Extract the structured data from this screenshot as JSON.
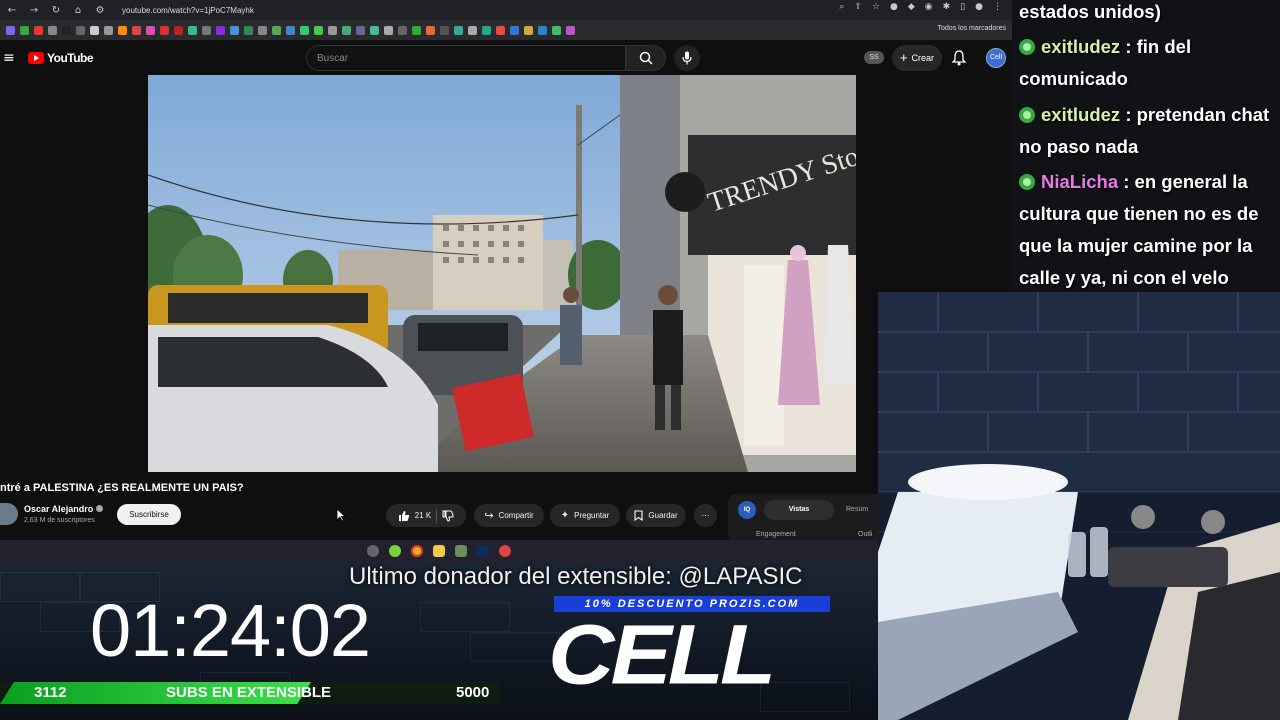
{
  "browser": {
    "url": "youtube.com/watch?v=1jPoC7Mayhk",
    "all_bookmarks": "Todos los marcadores"
  },
  "youtube": {
    "logo": "YouTube",
    "search_placeholder": "Buscar",
    "create_label": "Crear",
    "ss_badge": "SS",
    "avatar_label": "Cell"
  },
  "video": {
    "title": "ntré a PALESTINA ¿ES REALMENTE UN PAIS?",
    "channel": "Oscar Alejandro",
    "subscribers": "2,63 M de suscriptores",
    "subscribe": "Suscribirse",
    "likes": "21 K",
    "share": "Compartir",
    "ask": "Preguntar",
    "save": "Guardar",
    "more": "⋯"
  },
  "stats_panel": {
    "icon": "IQ",
    "tab_views": "Vistas",
    "tab_summary": "Resum",
    "engagement": "Engagement",
    "outline": "Outli"
  },
  "overlay": {
    "donor": "Ultimo donador del extensible: @LAPASIC",
    "discount": "10% DESCUENTO PROZIS.COM",
    "logo": "CELL",
    "timer": "01:24:02",
    "subs_current": "3112",
    "subs_label": "SUBS EN EXTENSIBLE",
    "subs_goal": "5000",
    "subs_progress": 0.6224
  },
  "chat": {
    "messages": [
      {
        "user": "",
        "text": "estados unidos)"
      },
      {
        "user": "exitludez",
        "text": ": fin del comunicado"
      },
      {
        "user": "exitludez",
        "text": ": pretendan chat no paso nada"
      },
      {
        "user": "NiaLicha",
        "text": ": en general la cultura que tienen no es de que la mujer camine por la calle y ya, ni con el velo"
      }
    ]
  },
  "colors": {
    "youtube_red": "#ff0000",
    "progress_green": "#3de04c",
    "discount_blue": "#1a3fd8",
    "chat_user_green": "#d8f0a8",
    "chat_user_pink": "#e879e8"
  }
}
